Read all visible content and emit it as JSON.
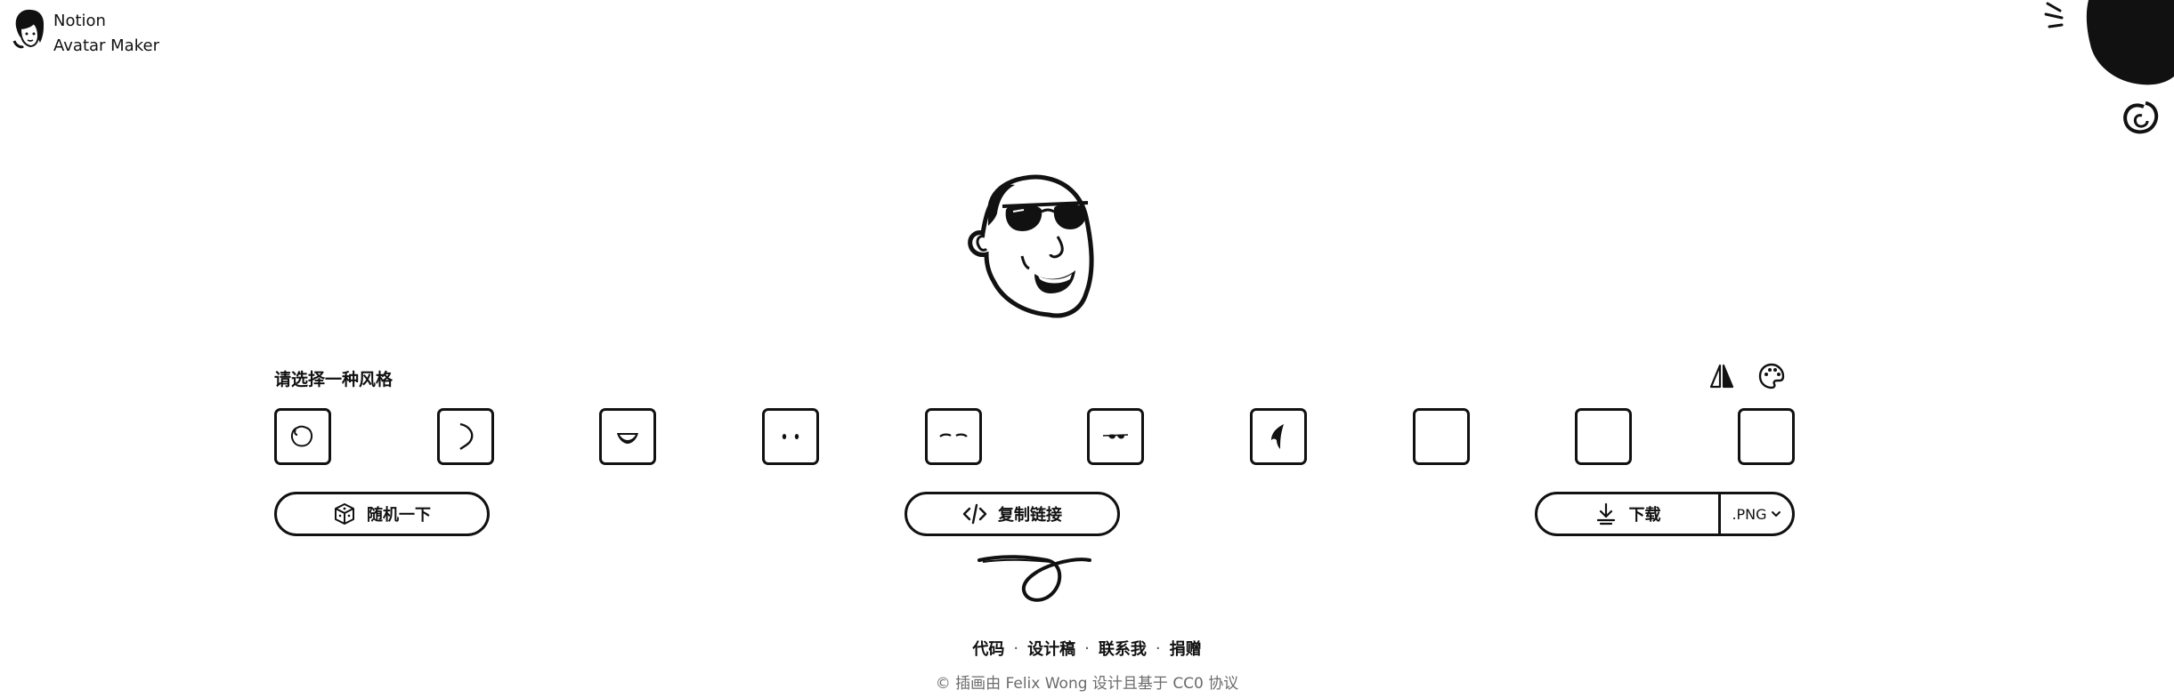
{
  "header": {
    "title_line1": "Notion",
    "title_line2": "Avatar Maker"
  },
  "section": {
    "title": "请选择一种风格"
  },
  "style_options": [
    {
      "name": "face"
    },
    {
      "name": "ears"
    },
    {
      "name": "mouth"
    },
    {
      "name": "eyes"
    },
    {
      "name": "eyebrows"
    },
    {
      "name": "glasses"
    },
    {
      "name": "hair"
    },
    {
      "name": "accessory"
    },
    {
      "name": "details"
    },
    {
      "name": "beard"
    }
  ],
  "actions": {
    "random_label": "随机一下",
    "copy_label": "复制链接",
    "download_label": "下载",
    "format_value": ".PNG"
  },
  "footer": {
    "links": [
      "代码",
      "设计稿",
      "联系我",
      "捐赠"
    ],
    "separator": "·",
    "credit": "© 插画由 Felix Wong 设计且基于 CC0 协议"
  },
  "icons": {
    "flip": "flip-icon",
    "palette": "palette-icon",
    "random": "cube-icon",
    "copy": "code-icon",
    "download": "download-icon",
    "format": "chevron-down-icon"
  }
}
